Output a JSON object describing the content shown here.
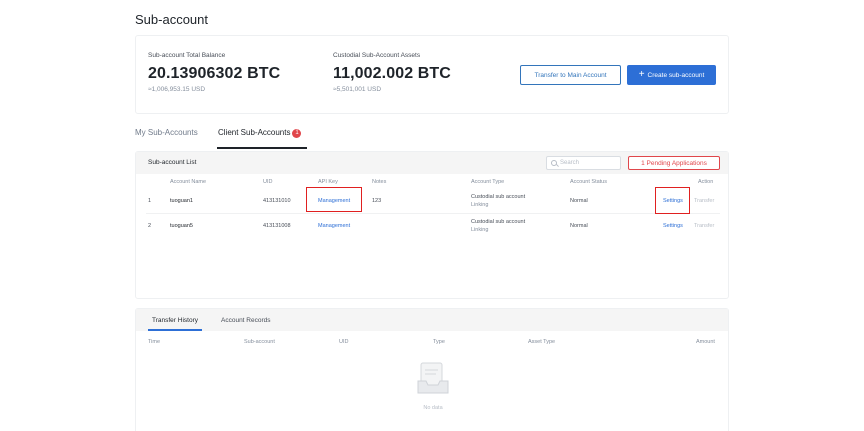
{
  "page": {
    "title": "Sub-account"
  },
  "balance": {
    "total_label": "Sub-account Total Balance",
    "total_value": "20.13906302 BTC",
    "total_usd": "≈1,006,953.15 USD",
    "custodial_label": "Custodial Sub-Account Assets",
    "custodial_value": "11,002.002 BTC",
    "custodial_usd": "≈5,501,001 USD",
    "transfer_button": "Transfer to Main Account",
    "create_button": "Create sub-account"
  },
  "tabs": [
    {
      "label": "My Sub-Accounts",
      "active": false
    },
    {
      "label": "Client Sub-Accounts",
      "active": true,
      "badge": "1"
    }
  ],
  "list": {
    "title": "Sub-account List",
    "search_placeholder": "Search",
    "pending_button": "1 Pending Applications",
    "columns": [
      "Account Name",
      "UID",
      "API Key",
      "Notes",
      "Account Type",
      "Account Status",
      "Action"
    ],
    "rows": [
      {
        "index": "1",
        "name": "tuoguan1",
        "uid": "413131010",
        "api_key": "Management",
        "notes": "123",
        "type_line1": "Custodial sub account",
        "type_line2": "Linking",
        "status": "Normal",
        "action_settings": "Settings",
        "action_transfer": "Transfer"
      },
      {
        "index": "2",
        "name": "tuoguan5",
        "uid": "413131008",
        "api_key": "Management",
        "notes": "",
        "type_line1": "Custodial sub account",
        "type_line2": "Linking",
        "status": "Normal",
        "action_settings": "Settings",
        "action_transfer": "Transfer"
      }
    ]
  },
  "history": {
    "tabs": [
      {
        "label": "Transfer History",
        "active": true
      },
      {
        "label": "Account Records",
        "active": false
      }
    ],
    "columns": [
      "Time",
      "Sub-account",
      "UID",
      "Type",
      "Asset Type",
      "Amount"
    ],
    "empty_text": "No data"
  },
  "colors": {
    "primary": "#2d6fd6",
    "danger": "#e0464b",
    "highlight_box": "#e02020"
  },
  "icons": {
    "create_button": "plus-icon",
    "search": "search-icon",
    "empty_state": "inbox-icon"
  }
}
